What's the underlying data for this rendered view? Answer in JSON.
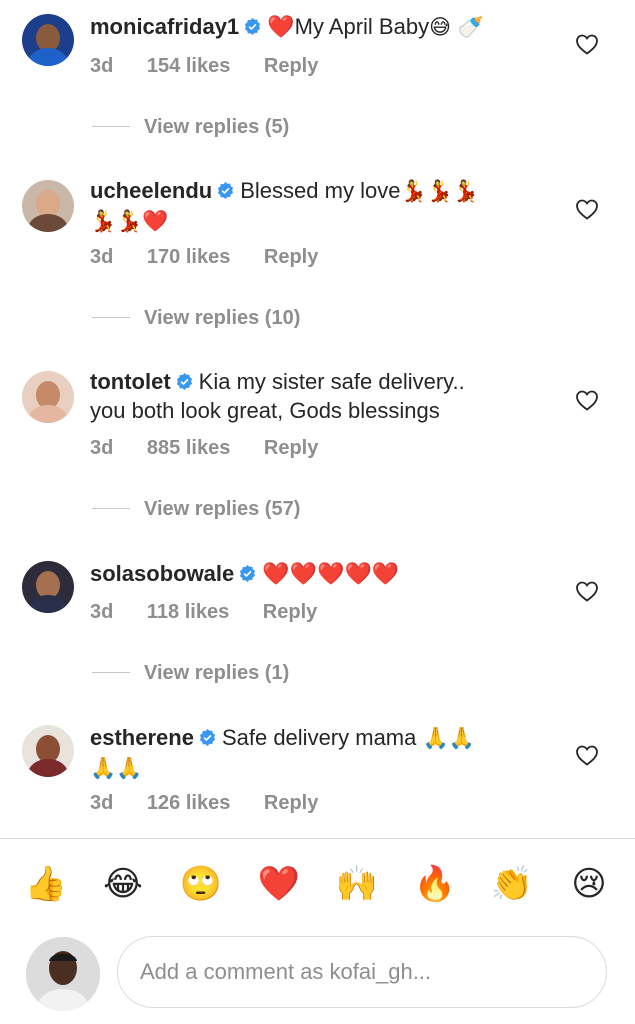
{
  "comments": [
    {
      "username": "monicafriday1",
      "text": "My April Baby",
      "emoji_before": "❤️",
      "emoji_after": "😅 🍼",
      "time": "3d",
      "likes": "154 likes",
      "reply": "Reply",
      "view_replies": "View replies (5)"
    },
    {
      "username": "ucheelendu",
      "text": "Blessed my love",
      "emoji_after": "💃💃💃",
      "line2": "💃💃❤️",
      "time": "3d",
      "likes": "170 likes",
      "reply": "Reply",
      "view_replies": "View replies (10)"
    },
    {
      "username": "tontolet",
      "text": "Kia my sister safe delivery..",
      "line2": "you both look great, Gods blessings",
      "time": "3d",
      "likes": "885 likes",
      "reply": "Reply",
      "view_replies": "View replies (57)"
    },
    {
      "username": "solasobowale",
      "text": "❤️❤️❤️❤️❤️",
      "time": "3d",
      "likes": "118 likes",
      "reply": "Reply",
      "view_replies": "View replies (1)"
    },
    {
      "username": "estherene",
      "text": "Safe delivery mama",
      "emoji_after": "🙏🙏",
      "line2": "🙏🙏",
      "time": "3d",
      "likes": "126 likes",
      "reply": "Reply"
    }
  ],
  "reactions": [
    "👍",
    "😂",
    "🙄",
    "❤️",
    "🙌",
    "🔥",
    "👏",
    "😢"
  ],
  "composer": {
    "placeholder": "Add a comment as kofai_gh..."
  },
  "colors": {
    "verified": "#3897f0",
    "muted": "#8e8e8e",
    "text": "#262626",
    "heart": "#e0142c"
  }
}
